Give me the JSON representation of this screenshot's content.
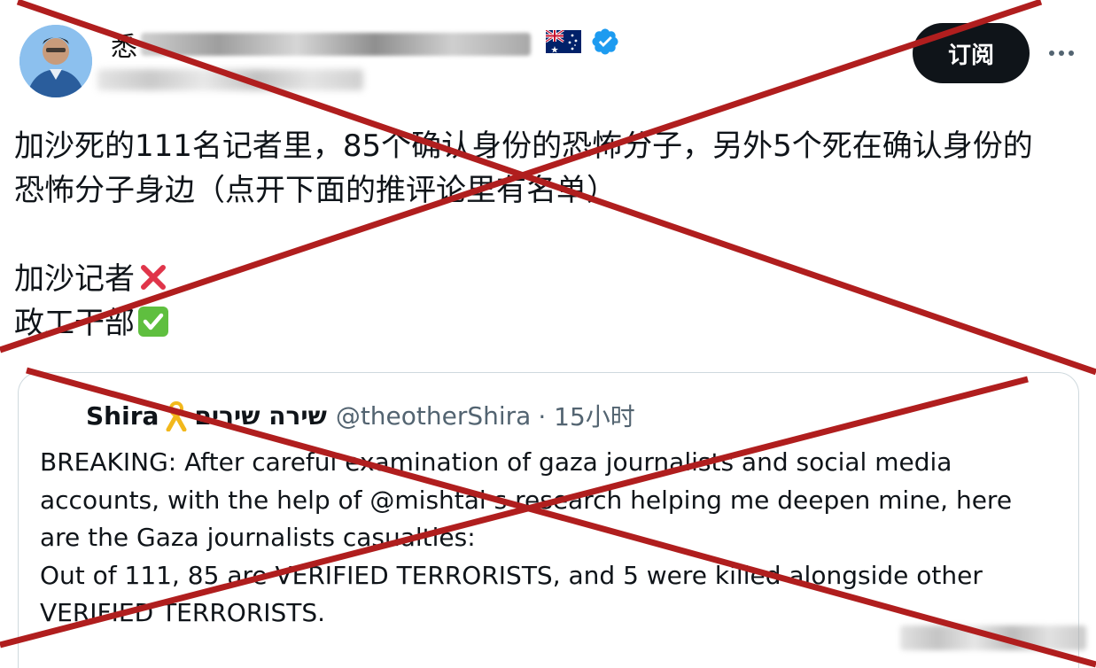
{
  "author": {
    "name_visible": "悉",
    "avatar_icon": "user-avatar-photo",
    "flag_icon": "australia-flag-icon",
    "verified_icon": "verified-badge-icon"
  },
  "actions": {
    "subscribe_label": "订阅",
    "more_icon": "more-options-icon"
  },
  "tweet": {
    "lines": [
      "加沙死的111名记者里，85个确认身份的恐怖分子，另外5个死在确认身份的",
      "恐怖分子身边（点开下面的推评论里有名单）",
      "",
      "加沙记者",
      "政工干部"
    ],
    "emoji_cross": "cross-mark-emoji",
    "emoji_check": "check-mark-emoji"
  },
  "quote": {
    "name": "Shira",
    "ribbon_icon": "yellow-ribbon-icon",
    "hebrew_name": "שירה שירים",
    "handle": "@theotherShira",
    "time": "· 15小时",
    "text_lines": [
      "BREAKING: After careful examination of gaza journalists and social media",
      "accounts, with the help of @mishtal s research helping me deepen mine, here",
      "are the Gaza journalists casualties:",
      "Out of 111, 85 are VERIFIED TERRORISTS, and 5 were killed alongside other",
      "VERIFIED TERRORISTS."
    ]
  },
  "overlay": {
    "color": "#b01e1e",
    "shape": "red-x-cross-out"
  },
  "colors": {
    "text": "#0f1419",
    "muted": "#536471",
    "verified": "#1d9bf0",
    "button_bg": "#0f1419",
    "border": "#cfd9de"
  }
}
